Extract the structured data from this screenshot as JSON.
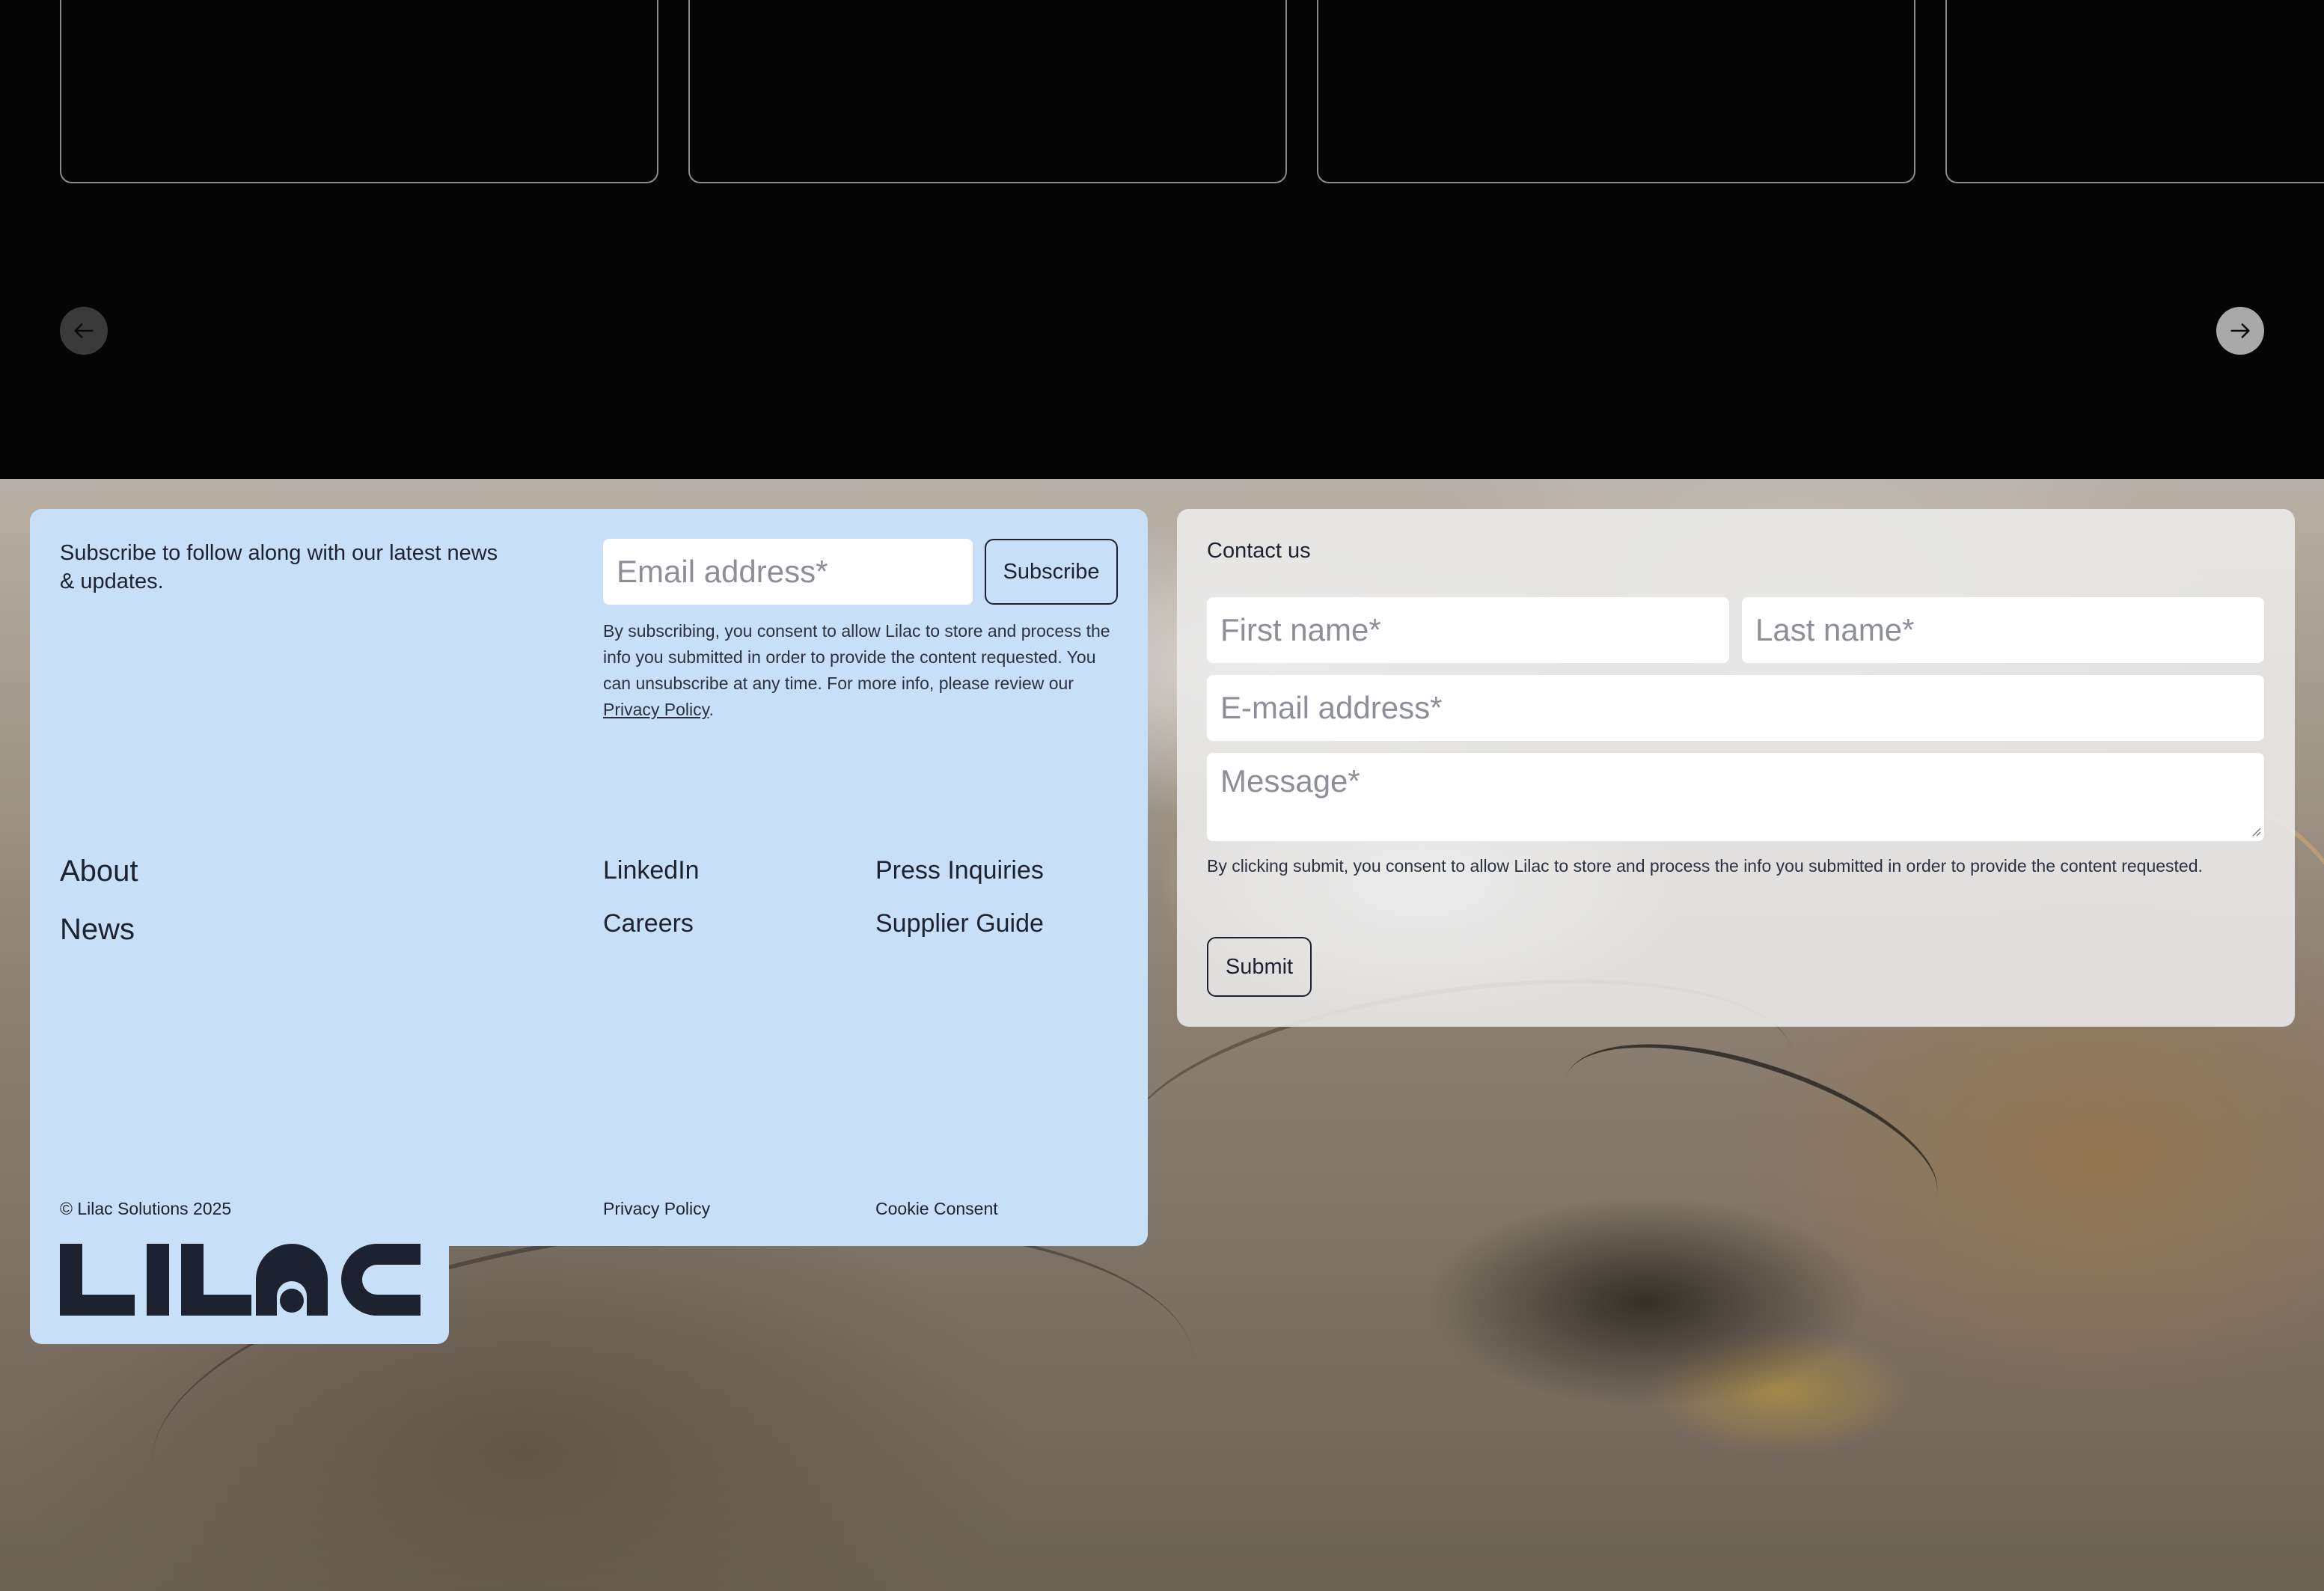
{
  "carousel": {
    "cards": [
      "",
      "",
      "",
      ""
    ],
    "prev_icon": "arrow-left-icon",
    "next_icon": "arrow-right-icon"
  },
  "subscribe": {
    "heading": "Subscribe to follow along with our latest news & updates.",
    "email_placeholder": "Email address*",
    "button_label": "Subscribe",
    "consent_prefix": "By subscribing, you consent to allow Lilac to store and process the info you submitted in order to provide the content requested. You can unsubscribe at any time. For more info, please review our ",
    "consent_link": "Privacy Policy",
    "consent_suffix": "."
  },
  "footer_nav": {
    "primary": [
      "About",
      "News"
    ],
    "col2": [
      "LinkedIn",
      "Careers"
    ],
    "col3": [
      "Press Inquiries",
      "Supplier Guide"
    ]
  },
  "legal": {
    "copyright": "© Lilac Solutions 2025",
    "privacy": "Privacy Policy",
    "cookie": "Cookie Consent"
  },
  "logo": {
    "text": "LILAC",
    "color": "#1d2230"
  },
  "contact": {
    "title": "Contact us",
    "first_name_placeholder": "First name*",
    "last_name_placeholder": "Last name*",
    "email_placeholder": "E-mail address*",
    "message_placeholder": "Message*",
    "consent": "By clicking submit, you consent to allow Lilac to store and process the info you submitted in order to provide the content requested.",
    "submit_label": "Submit"
  },
  "colors": {
    "footer_blue": "#c7e0f8",
    "dark_bg": "#050505",
    "text": "#1d2230"
  }
}
